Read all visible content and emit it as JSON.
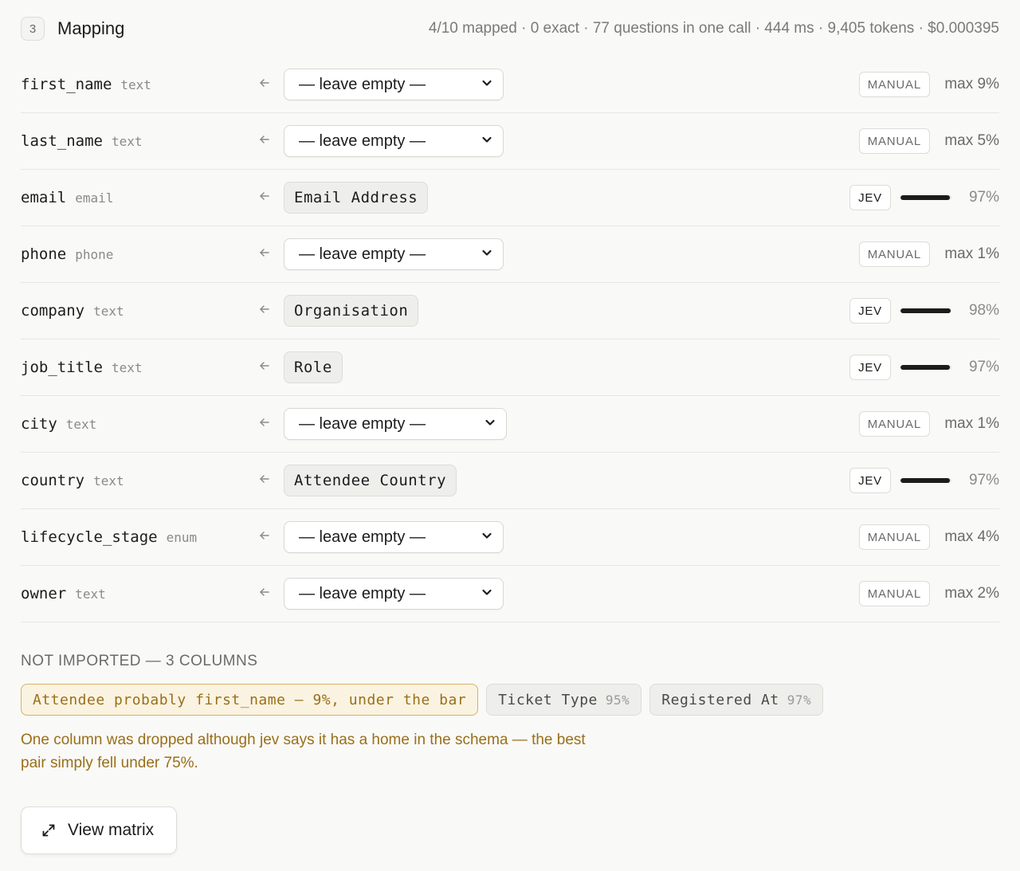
{
  "header": {
    "step": "3",
    "title": "Mapping",
    "stats": "4/10 mapped · 0 exact · 77 questions in one call · 444 ms · 9,405 tokens · $0.000395"
  },
  "rows": [
    {
      "field": "first_name",
      "type": "text",
      "source": "— leave empty —",
      "kind": "select",
      "method": "MANUAL",
      "score": "max 9%"
    },
    {
      "field": "last_name",
      "type": "text",
      "source": "— leave empty —",
      "kind": "select",
      "method": "MANUAL",
      "score": "max 5%"
    },
    {
      "field": "email",
      "type": "email",
      "source": "Email Address",
      "kind": "chip",
      "method": "JEV",
      "score": "97%",
      "confidence": 0.97
    },
    {
      "field": "phone",
      "type": "phone",
      "source": "— leave empty —",
      "kind": "select",
      "method": "MANUAL",
      "score": "max 1%"
    },
    {
      "field": "company",
      "type": "text",
      "source": "Organisation",
      "kind": "chip",
      "method": "JEV",
      "score": "98%",
      "confidence": 0.98
    },
    {
      "field": "job_title",
      "type": "text",
      "source": "Role",
      "kind": "chip",
      "method": "JEV",
      "score": "97%",
      "confidence": 0.97
    },
    {
      "field": "city",
      "type": "text",
      "source": "— leave empty —",
      "kind": "select",
      "method": "MANUAL",
      "score": "max 1%"
    },
    {
      "field": "country",
      "type": "text",
      "source": "Attendee Country",
      "kind": "chip",
      "method": "JEV",
      "score": "97%",
      "confidence": 0.97
    },
    {
      "field": "lifecycle_stage",
      "type": "enum",
      "source": "— leave empty —",
      "kind": "select",
      "method": "MANUAL",
      "score": "max 4%"
    },
    {
      "field": "owner",
      "type": "text",
      "source": "— leave empty —",
      "kind": "select",
      "method": "MANUAL",
      "score": "max 2%"
    }
  ],
  "not_imported": {
    "label": "NOT IMPORTED — 3 COLUMNS",
    "columns": [
      {
        "text": "Attendee probably first_name — 9%, under the bar",
        "pct": "",
        "warn": true
      },
      {
        "text": "Ticket Type",
        "pct": "95%",
        "warn": false
      },
      {
        "text": "Registered At",
        "pct": "97%",
        "warn": false
      }
    ],
    "note": "One column was dropped although jev says it has a home in the schema — the best pair simply fell under 75%."
  },
  "actions": {
    "view_matrix": "View matrix"
  },
  "colors": {
    "accent_warn": "#9a6f1a",
    "warn_bg": "#faf3e1",
    "bar": "#1c1c1c"
  },
  "icons": {
    "arrow": "arrow-left-icon",
    "select": "chevron-down-icon",
    "matrix": "expand-icon"
  }
}
